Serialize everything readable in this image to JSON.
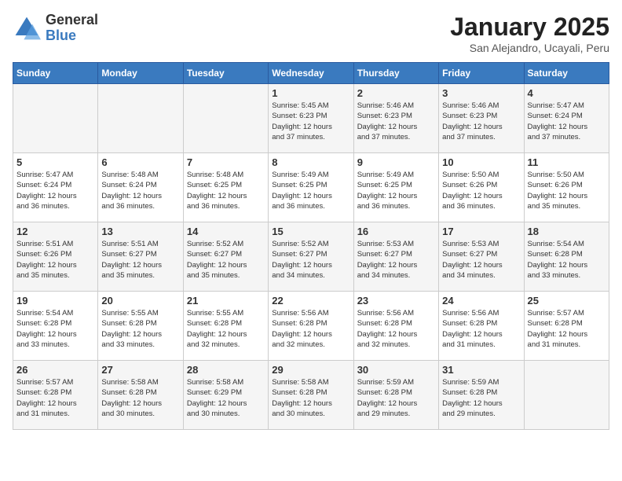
{
  "logo": {
    "text_general": "General",
    "text_blue": "Blue"
  },
  "title": "January 2025",
  "subtitle": "San Alejandro, Ucayali, Peru",
  "days_header": [
    "Sunday",
    "Monday",
    "Tuesday",
    "Wednesday",
    "Thursday",
    "Friday",
    "Saturday"
  ],
  "weeks": [
    [
      {
        "day": "",
        "info": ""
      },
      {
        "day": "",
        "info": ""
      },
      {
        "day": "",
        "info": ""
      },
      {
        "day": "1",
        "info": "Sunrise: 5:45 AM\nSunset: 6:23 PM\nDaylight: 12 hours\nand 37 minutes."
      },
      {
        "day": "2",
        "info": "Sunrise: 5:46 AM\nSunset: 6:23 PM\nDaylight: 12 hours\nand 37 minutes."
      },
      {
        "day": "3",
        "info": "Sunrise: 5:46 AM\nSunset: 6:23 PM\nDaylight: 12 hours\nand 37 minutes."
      },
      {
        "day": "4",
        "info": "Sunrise: 5:47 AM\nSunset: 6:24 PM\nDaylight: 12 hours\nand 37 minutes."
      }
    ],
    [
      {
        "day": "5",
        "info": "Sunrise: 5:47 AM\nSunset: 6:24 PM\nDaylight: 12 hours\nand 36 minutes."
      },
      {
        "day": "6",
        "info": "Sunrise: 5:48 AM\nSunset: 6:24 PM\nDaylight: 12 hours\nand 36 minutes."
      },
      {
        "day": "7",
        "info": "Sunrise: 5:48 AM\nSunset: 6:25 PM\nDaylight: 12 hours\nand 36 minutes."
      },
      {
        "day": "8",
        "info": "Sunrise: 5:49 AM\nSunset: 6:25 PM\nDaylight: 12 hours\nand 36 minutes."
      },
      {
        "day": "9",
        "info": "Sunrise: 5:49 AM\nSunset: 6:25 PM\nDaylight: 12 hours\nand 36 minutes."
      },
      {
        "day": "10",
        "info": "Sunrise: 5:50 AM\nSunset: 6:26 PM\nDaylight: 12 hours\nand 36 minutes."
      },
      {
        "day": "11",
        "info": "Sunrise: 5:50 AM\nSunset: 6:26 PM\nDaylight: 12 hours\nand 35 minutes."
      }
    ],
    [
      {
        "day": "12",
        "info": "Sunrise: 5:51 AM\nSunset: 6:26 PM\nDaylight: 12 hours\nand 35 minutes."
      },
      {
        "day": "13",
        "info": "Sunrise: 5:51 AM\nSunset: 6:27 PM\nDaylight: 12 hours\nand 35 minutes."
      },
      {
        "day": "14",
        "info": "Sunrise: 5:52 AM\nSunset: 6:27 PM\nDaylight: 12 hours\nand 35 minutes."
      },
      {
        "day": "15",
        "info": "Sunrise: 5:52 AM\nSunset: 6:27 PM\nDaylight: 12 hours\nand 34 minutes."
      },
      {
        "day": "16",
        "info": "Sunrise: 5:53 AM\nSunset: 6:27 PM\nDaylight: 12 hours\nand 34 minutes."
      },
      {
        "day": "17",
        "info": "Sunrise: 5:53 AM\nSunset: 6:27 PM\nDaylight: 12 hours\nand 34 minutes."
      },
      {
        "day": "18",
        "info": "Sunrise: 5:54 AM\nSunset: 6:28 PM\nDaylight: 12 hours\nand 33 minutes."
      }
    ],
    [
      {
        "day": "19",
        "info": "Sunrise: 5:54 AM\nSunset: 6:28 PM\nDaylight: 12 hours\nand 33 minutes."
      },
      {
        "day": "20",
        "info": "Sunrise: 5:55 AM\nSunset: 6:28 PM\nDaylight: 12 hours\nand 33 minutes."
      },
      {
        "day": "21",
        "info": "Sunrise: 5:55 AM\nSunset: 6:28 PM\nDaylight: 12 hours\nand 32 minutes."
      },
      {
        "day": "22",
        "info": "Sunrise: 5:56 AM\nSunset: 6:28 PM\nDaylight: 12 hours\nand 32 minutes."
      },
      {
        "day": "23",
        "info": "Sunrise: 5:56 AM\nSunset: 6:28 PM\nDaylight: 12 hours\nand 32 minutes."
      },
      {
        "day": "24",
        "info": "Sunrise: 5:56 AM\nSunset: 6:28 PM\nDaylight: 12 hours\nand 31 minutes."
      },
      {
        "day": "25",
        "info": "Sunrise: 5:57 AM\nSunset: 6:28 PM\nDaylight: 12 hours\nand 31 minutes."
      }
    ],
    [
      {
        "day": "26",
        "info": "Sunrise: 5:57 AM\nSunset: 6:28 PM\nDaylight: 12 hours\nand 31 minutes."
      },
      {
        "day": "27",
        "info": "Sunrise: 5:58 AM\nSunset: 6:28 PM\nDaylight: 12 hours\nand 30 minutes."
      },
      {
        "day": "28",
        "info": "Sunrise: 5:58 AM\nSunset: 6:29 PM\nDaylight: 12 hours\nand 30 minutes."
      },
      {
        "day": "29",
        "info": "Sunrise: 5:58 AM\nSunset: 6:28 PM\nDaylight: 12 hours\nand 30 minutes."
      },
      {
        "day": "30",
        "info": "Sunrise: 5:59 AM\nSunset: 6:28 PM\nDaylight: 12 hours\nand 29 minutes."
      },
      {
        "day": "31",
        "info": "Sunrise: 5:59 AM\nSunset: 6:28 PM\nDaylight: 12 hours\nand 29 minutes."
      },
      {
        "day": "",
        "info": ""
      }
    ]
  ]
}
